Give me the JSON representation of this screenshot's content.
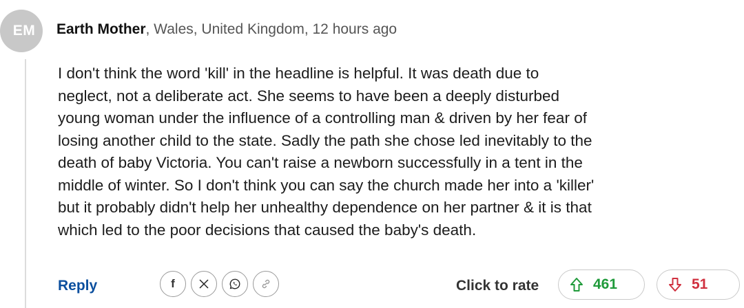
{
  "avatar": {
    "initials": "EM"
  },
  "comment": {
    "author": "Earth Mother",
    "location_time": ", Wales, United Kingdom, 12 hours ago",
    "lines": [
      "I don't think the word 'kill' in the headline is helpful. It was death due to",
      "neglect, not a deliberate act. She seems to have been a deeply disturbed",
      "young woman under the influence of a controlling man & driven by her fear of",
      "losing another child to the state. Sadly the path she chose led inevitably to the",
      "death of baby Victoria. You can't raise a newborn successfully in a tent in the",
      "middle of winter. So I don't think you can say the church made her into a 'killer'",
      "but it probably didn't help her unhealthy dependence on her partner & it is that",
      "which led to the poor decisions that caused the baby's death."
    ]
  },
  "actions": {
    "reply_label": "Reply",
    "share_icons": [
      "facebook-icon",
      "x-icon",
      "whatsapp-icon",
      "link-icon"
    ],
    "rate_label": "Click to rate",
    "upvotes": "461",
    "downvotes": "51"
  },
  "colors": {
    "reply": "#0b4f9e",
    "upvote": "#1f9a3a",
    "downvote": "#d0303f",
    "avatar_bg": "#c8c8c8"
  }
}
